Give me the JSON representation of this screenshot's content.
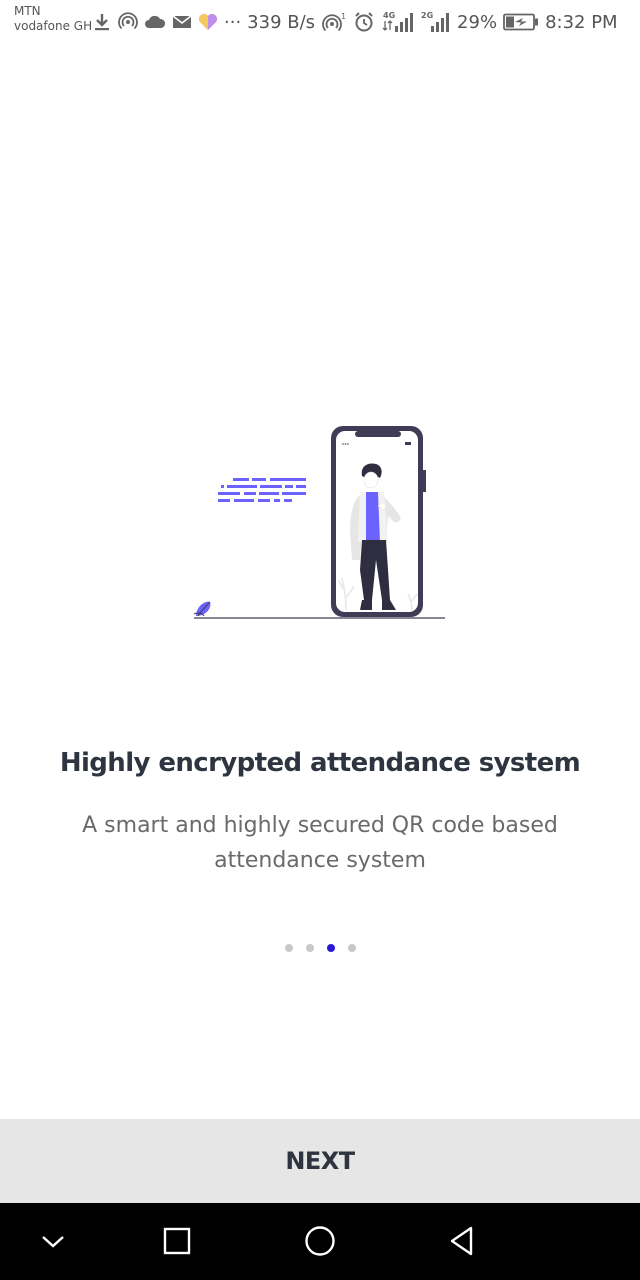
{
  "status_bar": {
    "carrier_1": "MTN",
    "carrier_2": "vodafone GH",
    "dots": "···",
    "net_speed": "339 B/s",
    "network_4g": "4G",
    "network_2g": "2G",
    "battery_percent": "29%",
    "time": "8:32 PM",
    "icons": [
      "download-icon",
      "hotspot-icon",
      "cloud-icon",
      "mail-icon",
      "heart-app-icon",
      "wifi-icon",
      "alarm-icon",
      "signal-icon",
      "battery-charging-icon"
    ]
  },
  "onboarding": {
    "title": "Highly encrypted attendance system",
    "description": "A smart and highly secured QR code based attendance system",
    "page_index": 3,
    "page_count": 4
  },
  "next_button": {
    "label": "NEXT"
  },
  "nav_bar": {
    "icons": [
      "chevron-down-icon",
      "recents-square-icon",
      "home-circle-icon",
      "back-triangle-icon"
    ]
  },
  "colors": {
    "accent": "#2a18d8",
    "illustration_purple": "#6c63ff",
    "text_dark": "#2e3440",
    "text_muted": "#6a6a6a",
    "next_bar_bg": "#e6e6e6",
    "nav_bar_bg": "#000000"
  }
}
